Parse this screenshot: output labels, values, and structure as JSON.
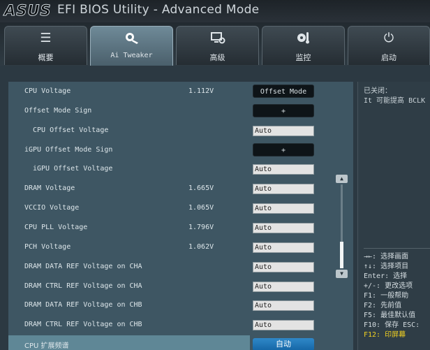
{
  "title": {
    "brand": "ASUS",
    "app": "EFI BIOS Utility - Advanced Mode"
  },
  "tabs": [
    {
      "label": "概要",
      "icon": "list-icon",
      "active": false
    },
    {
      "label": "Ai Tweaker",
      "icon": "tweaker-icon",
      "active": true
    },
    {
      "label": "高级",
      "icon": "advanced-icon",
      "active": false
    },
    {
      "label": "监控",
      "icon": "monitor-icon",
      "active": false
    },
    {
      "label": "启动",
      "icon": "power-icon",
      "active": false
    }
  ],
  "settings": [
    {
      "label": "CPU Voltage",
      "value": "1.112V",
      "control": "Offset Mode"
    },
    {
      "label": "Offset Mode Sign",
      "value": "",
      "control": "+"
    },
    {
      "label": "CPU Offset Voltage",
      "value": "",
      "control": "Auto"
    },
    {
      "label": "iGPU Offset Mode Sign",
      "value": "",
      "control": "+"
    },
    {
      "label": "iGPU Offset Voltage",
      "value": "",
      "control": "Auto"
    },
    {
      "label": "DRAM Voltage",
      "value": "1.665V",
      "control": "Auto"
    },
    {
      "label": "VCCIO Voltage",
      "value": "1.065V",
      "control": "Auto"
    },
    {
      "label": "CPU PLL Voltage",
      "value": "1.796V",
      "control": "Auto"
    },
    {
      "label": "PCH Voltage",
      "value": "1.062V",
      "control": "Auto"
    },
    {
      "label": "DRAM DATA REF Voltage on CHA",
      "value": "",
      "control": "Auto"
    },
    {
      "label": "DRAM CTRL REF Voltage on CHA",
      "value": "",
      "control": "Auto"
    },
    {
      "label": "DRAM DATA REF Voltage on CHB",
      "value": "",
      "control": "Auto"
    },
    {
      "label": "DRAM CTRL REF Voltage on CHB",
      "value": "",
      "control": "Auto"
    },
    {
      "label": "CPU 扩展频谱",
      "value": "",
      "control": "自动"
    }
  ],
  "help": {
    "line1": "已关闭：",
    "line2": "It 可能提高 BCLK"
  },
  "keys": [
    {
      "text": "→←: 选择画面",
      "highlight": false
    },
    {
      "text": "↑↓: 选择项目",
      "highlight": false
    },
    {
      "text": "Enter: 选择",
      "highlight": false
    },
    {
      "text": "+/-: 更改选项",
      "highlight": false
    },
    {
      "text": "F1: 一般帮助",
      "highlight": false
    },
    {
      "text": "F2: 先前值",
      "highlight": false
    },
    {
      "text": "F5: 最佳默认值",
      "highlight": false
    },
    {
      "text": "F10: 保存  ESC:",
      "highlight": false
    },
    {
      "text": "F12: 印屏幕",
      "highlight": true
    }
  ],
  "colors": {
    "accent": "#1f78b8",
    "panel": "#3e5663",
    "selected_row": "#5f8796",
    "hotkey": "#f3d221"
  }
}
